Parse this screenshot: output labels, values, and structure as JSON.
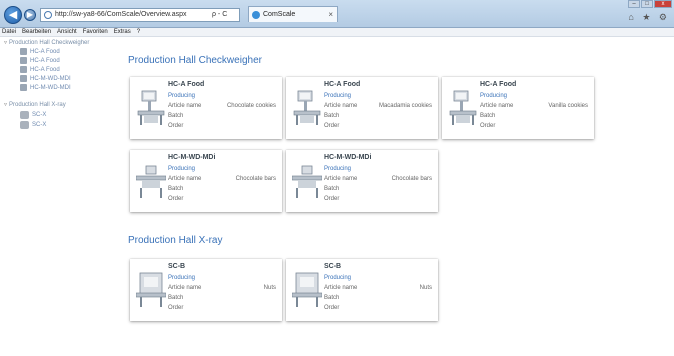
{
  "browser": {
    "address": "http://sw-ya8-66/ComScale/Overview.aspx",
    "address_actions": "ρ - C",
    "tab_title": "ComScale",
    "tab_close": "×",
    "window_controls": [
      "–",
      "□",
      "x"
    ],
    "tool_icons": "⌂ ★ ⚙"
  },
  "menubar": {
    "items": [
      "Datei",
      "Bearbeiten",
      "Ansicht",
      "Favoriten",
      "Extras",
      "?"
    ]
  },
  "sidebar": {
    "groups": [
      {
        "label": "Production Hall Checkweigher",
        "items": [
          "HC-A Food",
          "HC-A Food",
          "HC-A Food",
          "HC-M-WD-MDI",
          "HC-M-WD-MDI"
        ]
      },
      {
        "label": "Production Hall X-ray",
        "items": [
          "SC-X",
          "SC-X"
        ]
      }
    ]
  },
  "sections": [
    {
      "title": "Production Hall Checkweigher",
      "cards": [
        {
          "name": "HC-A Food",
          "status": "Producing",
          "article_label": "Article name",
          "article_value": "Chocolate cookies",
          "batch_label": "Batch",
          "order_label": "Order"
        },
        {
          "name": "HC-A Food",
          "status": "Producing",
          "article_label": "Article name",
          "article_value": "Macadamia cookies",
          "batch_label": "Batch",
          "order_label": "Order"
        },
        {
          "name": "HC-A Food",
          "status": "Producing",
          "article_label": "Article name",
          "article_value": "Vanilla cookies",
          "batch_label": "Batch",
          "order_label": "Order"
        },
        {
          "name": "HC-M-WD-MDi",
          "status": "Producing",
          "article_label": "Article name",
          "article_value": "Chocolate bars",
          "batch_label": "Batch",
          "order_label": "Order"
        },
        {
          "name": "HC-M-WD-MDi",
          "status": "Producing",
          "article_label": "Article name",
          "article_value": "Chocolate bars",
          "batch_label": "Batch",
          "order_label": "Order"
        }
      ]
    },
    {
      "title": "Production Hall X-ray",
      "cards": [
        {
          "name": "SC-B",
          "status": "Producing",
          "article_label": "Article name",
          "article_value": "Nuts",
          "batch_label": "Batch",
          "order_label": "Order"
        },
        {
          "name": "SC-B",
          "status": "Producing",
          "article_label": "Article name",
          "article_value": "Nuts",
          "batch_label": "Batch",
          "order_label": "Order"
        }
      ]
    }
  ],
  "colors": {
    "accent": "#3a72b8",
    "card_title": "#3a4650",
    "muted_text": "#666666"
  }
}
